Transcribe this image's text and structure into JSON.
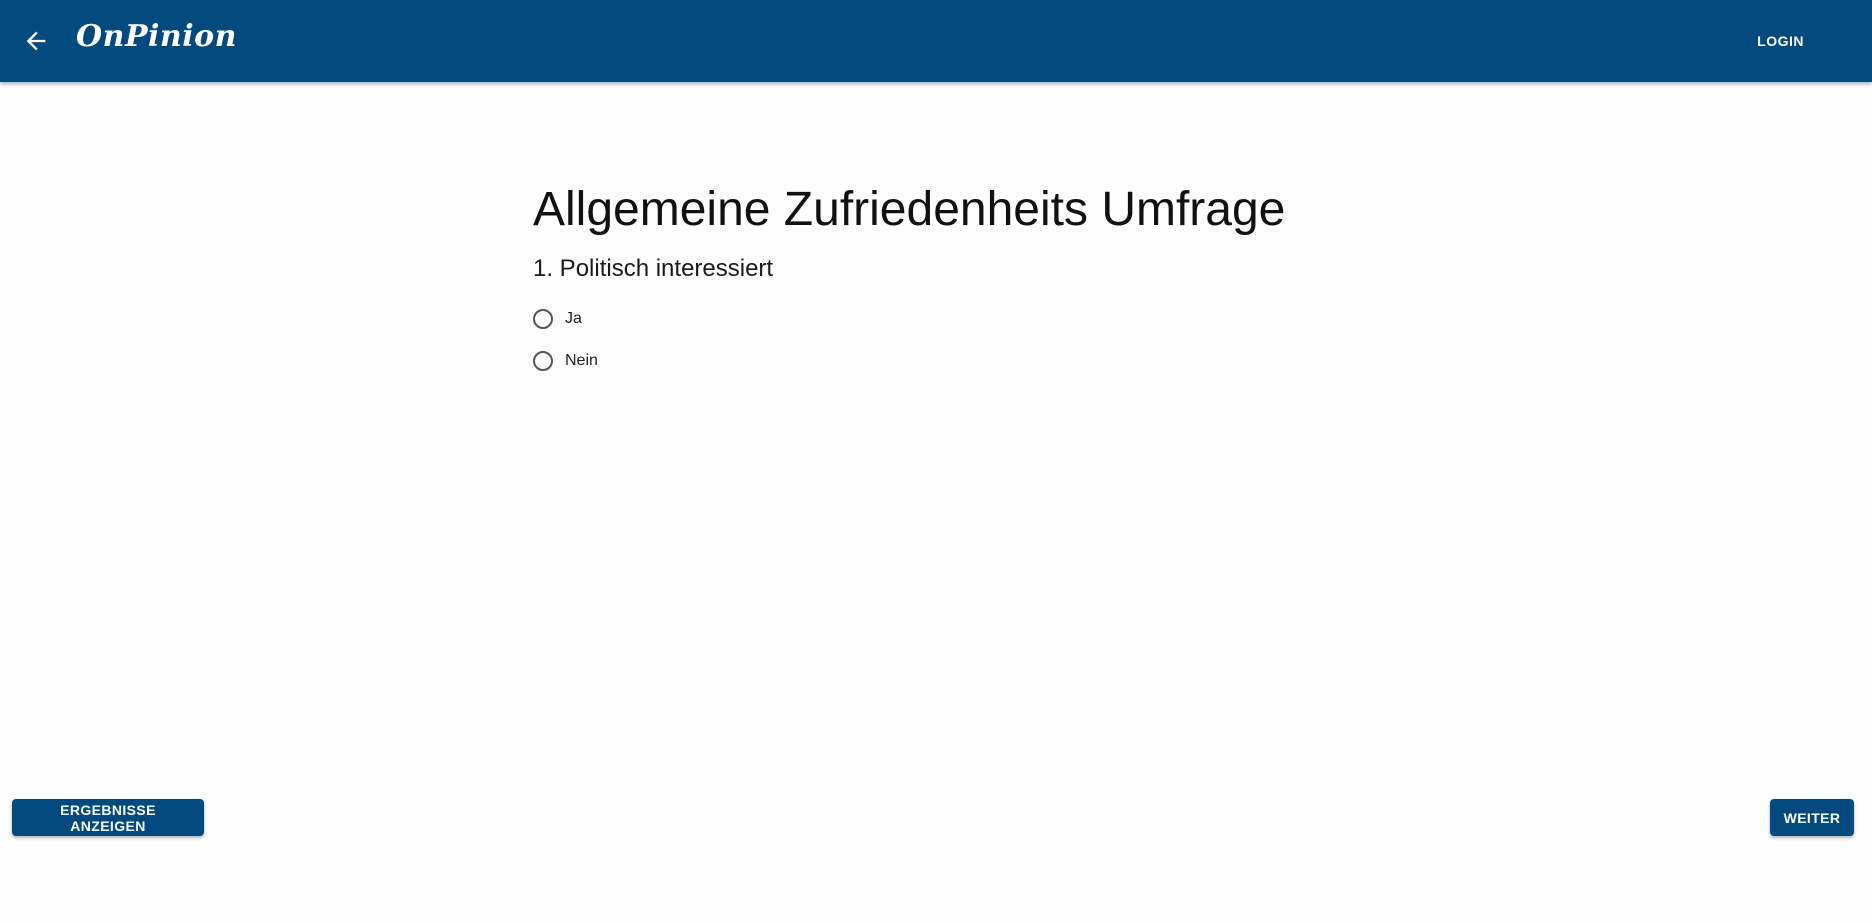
{
  "header": {
    "back_icon": "arrow-left-icon",
    "brand": "OnPinion",
    "login_label": "LOGIN",
    "color": "#02497e"
  },
  "survey": {
    "title": "Allgemeine Zufriedenheits Umfrage",
    "question": "1. Politisch interessiert",
    "options": [
      {
        "label": "Ja",
        "selected": false
      },
      {
        "label": "Nein",
        "selected": false
      }
    ]
  },
  "footer": {
    "results_label": "ERGEBNISSE ANZEIGEN",
    "next_label": "WEITER"
  }
}
